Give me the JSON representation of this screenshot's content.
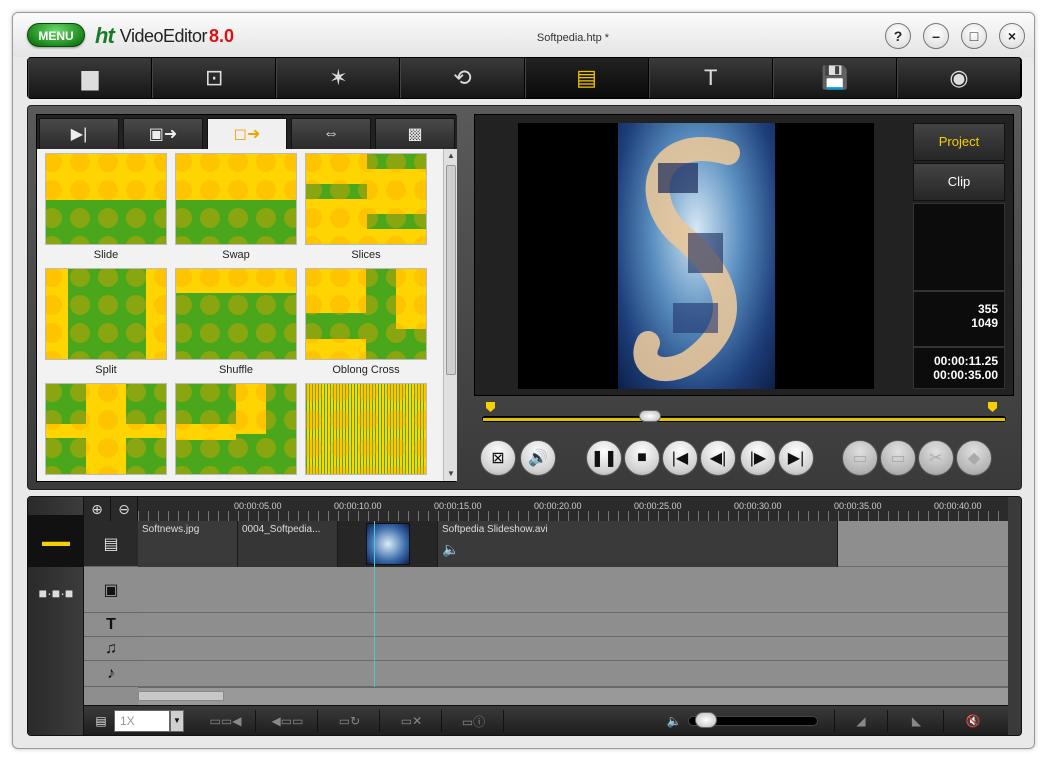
{
  "app": {
    "menu_label": "MENU",
    "logo_mark": "ht",
    "logo_name": "VideoEditor",
    "logo_version": "8.0",
    "file_title": "Softpedia.htp *",
    "window_buttons": [
      "?",
      "–",
      "□",
      "×"
    ]
  },
  "toolbar": {
    "items": [
      {
        "name": "new-project",
        "icon": "document-icon",
        "glyph": "▆"
      },
      {
        "name": "capture",
        "icon": "camcorder-icon",
        "glyph": "⊡"
      },
      {
        "name": "effects",
        "icon": "magic-wand-icon",
        "glyph": "✶"
      },
      {
        "name": "transitions",
        "icon": "transition-icon",
        "glyph": "⟲"
      },
      {
        "name": "timeline",
        "icon": "filmstrip-icon",
        "glyph": "▤"
      },
      {
        "name": "text",
        "icon": "text-icon",
        "glyph": "T"
      },
      {
        "name": "save",
        "icon": "floppy-icon",
        "glyph": "💾"
      },
      {
        "name": "burn",
        "icon": "disc-icon",
        "glyph": "◉"
      }
    ],
    "active_index": 4
  },
  "transition_tabs": [
    "▶|",
    "▣➜",
    "◻➜",
    "⇔",
    "▩"
  ],
  "active_tab": 2,
  "transitions": [
    {
      "label": "Slide",
      "pattern": "slide"
    },
    {
      "label": "Swap",
      "pattern": "swap"
    },
    {
      "label": "Slices",
      "pattern": "slices"
    },
    {
      "label": "Split",
      "pattern": "split"
    },
    {
      "label": "Shuffle",
      "pattern": "shuffle"
    },
    {
      "label": "Oblong Cross",
      "pattern": "oblong"
    },
    {
      "label": "",
      "pattern": "cross1"
    },
    {
      "label": "",
      "pattern": "cross2"
    },
    {
      "label": "",
      "pattern": "lines"
    }
  ],
  "preview": {
    "project_label": "Project",
    "clip_label": "Clip",
    "counter_a": "355",
    "counter_b": "1049",
    "time_current": "00:00:11.25",
    "time_total": "00:00:35.00",
    "position_fraction": 0.32
  },
  "timeline": {
    "ruler": [
      "00:00:05.00",
      "00:00:10.00",
      "00:00:15.00",
      "00:00:20.00",
      "00:00:25.00",
      "00:00:30.00",
      "00:00:35.00",
      "00:00:40.00"
    ],
    "clips": [
      "Softnews.jpg",
      "0004_Softpedia...",
      "",
      "Softpedia Slideshow.avi"
    ],
    "speed_value": "1X",
    "volume_fraction": 0.05
  },
  "colors": {
    "accent": "#f4d100",
    "transition_yellow": "#ffd400",
    "transition_green": "#4aa61a",
    "transition_orange": "#ffa800"
  }
}
